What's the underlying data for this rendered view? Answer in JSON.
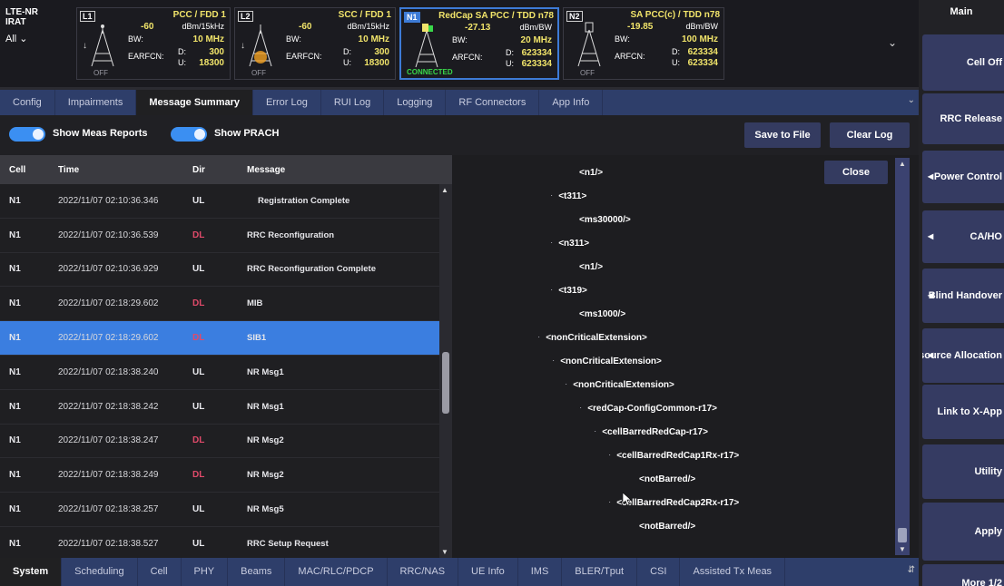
{
  "rat": {
    "line1": "LTE-NR",
    "line2": "IRAT",
    "all": "All"
  },
  "cells": [
    {
      "tag": "L1",
      "title": "PCC  /  FDD      1",
      "power": "-60",
      "power_unit": "dBm/15kHz",
      "bw_label": "BW:",
      "bw": "10  MHz",
      "arfcn_label": "EARFCN:",
      "d_label": "D:",
      "dl": "300",
      "u_label": "U:",
      "ul": "18300",
      "state": "OFF"
    },
    {
      "tag": "L2",
      "title": "SCC  /  FDD      1",
      "power": "-60",
      "power_unit": "dBm/15kHz",
      "bw_label": "BW:",
      "bw": "10  MHz",
      "arfcn_label": "EARFCN:",
      "d_label": "D:",
      "dl": "300",
      "u_label": "U:",
      "ul": "18300",
      "state": "OFF"
    },
    {
      "tag": "N1",
      "title": "RedCap SA PCC / TDD   n78",
      "power": "-27.13",
      "power_unit": "dBm/BW",
      "bw_label": "BW:",
      "bw": "20  MHz",
      "arfcn_label": "ARFCN:",
      "d_label": "D:",
      "dl": "623334",
      "u_label": "U:",
      "ul": "623334",
      "state": "CONNECTED"
    },
    {
      "tag": "N2",
      "title": "SA PCC(c) / TDD    n78",
      "power": "-19.85",
      "power_unit": "dBm/BW",
      "bw_label": "BW:",
      "bw": "100  MHz",
      "arfcn_label": "ARFCN:",
      "d_label": "D:",
      "dl": "623334",
      "u_label": "U:",
      "ul": "623334",
      "state": "OFF"
    }
  ],
  "tabs": [
    "Config",
    "Impairments",
    "Message Summary",
    "Error Log",
    "RUI Log",
    "Logging",
    "RF Connectors",
    "App Info"
  ],
  "active_tab": "Message Summary",
  "toggles": {
    "meas": "Show Meas Reports",
    "prach": "Show PRACH"
  },
  "buttons": {
    "save": "Save to File",
    "clear": "Clear Log",
    "close": "Close"
  },
  "table": {
    "headers": {
      "cell": "Cell",
      "time": "Time",
      "dir": "Dir",
      "message": "Message"
    },
    "rows": [
      {
        "cell": "N1",
        "time": "2022/11/07 02:10:36.346",
        "dir": "UL",
        "msg": "Registration Complete"
      },
      {
        "cell": "N1",
        "time": "2022/11/07 02:10:36.539",
        "dir": "DL",
        "msg": "RRC Reconfiguration"
      },
      {
        "cell": "N1",
        "time": "2022/11/07 02:10:36.929",
        "dir": "UL",
        "msg": "RRC Reconfiguration Complete"
      },
      {
        "cell": "N1",
        "time": "2022/11/07 02:18:29.602",
        "dir": "DL",
        "msg": "MIB"
      },
      {
        "cell": "N1",
        "time": "2022/11/07 02:18:29.602",
        "dir": "DL",
        "msg": "SIB1"
      },
      {
        "cell": "N1",
        "time": "2022/11/07 02:18:38.240",
        "dir": "UL",
        "msg": "NR Msg1"
      },
      {
        "cell": "N1",
        "time": "2022/11/07 02:18:38.242",
        "dir": "UL",
        "msg": "NR Msg1"
      },
      {
        "cell": "N1",
        "time": "2022/11/07 02:18:38.247",
        "dir": "DL",
        "msg": "NR Msg2"
      },
      {
        "cell": "N1",
        "time": "2022/11/07 02:18:38.249",
        "dir": "DL",
        "msg": "NR Msg2"
      },
      {
        "cell": "N1",
        "time": "2022/11/07 02:18:38.257",
        "dir": "UL",
        "msg": "NR Msg5"
      },
      {
        "cell": "N1",
        "time": "2022/11/07 02:18:38.527",
        "dir": "UL",
        "msg": "RRC Setup Request"
      }
    ]
  },
  "tree": [
    "<n1/>",
    "<t311>",
    "<ms30000/>",
    "<n311>",
    "<n1/>",
    "<t319>",
    "<ms1000/>",
    "<nonCriticalExtension>",
    "<nonCriticalExtension>",
    "<nonCriticalExtension>",
    "<redCap-ConfigCommon-r17>",
    "<cellBarredRedCap-r17>",
    "<cellBarredRedCap1Rx-r17>",
    "<notBarred/>",
    "<cellBarredRedCap2Rx-r17>",
    "<notBarred/>"
  ],
  "bottom_tabs": [
    "System",
    "Scheduling",
    "Cell",
    "PHY",
    "Beams",
    "MAC/RLC/PDCP",
    "RRC/NAS",
    "UE Info",
    "IMS",
    "BLER/Tput",
    "CSI",
    "Assisted Tx Meas"
  ],
  "active_bottom_tab": "System",
  "sidebar": {
    "title": "Main",
    "buttons": [
      "Cell Off",
      "RRC Release",
      "Power Control",
      "CA/HO",
      "Blind Handover",
      "Resource Allocation",
      "Link to X-App",
      "Utility",
      "Apply",
      "More 1/2"
    ]
  },
  "colors": {
    "accent": "#3b7ee0",
    "tab_bg": "#2e3e6a",
    "dl": "#e04a6a",
    "yellow": "#f1e46a",
    "connected": "#39d84a"
  }
}
